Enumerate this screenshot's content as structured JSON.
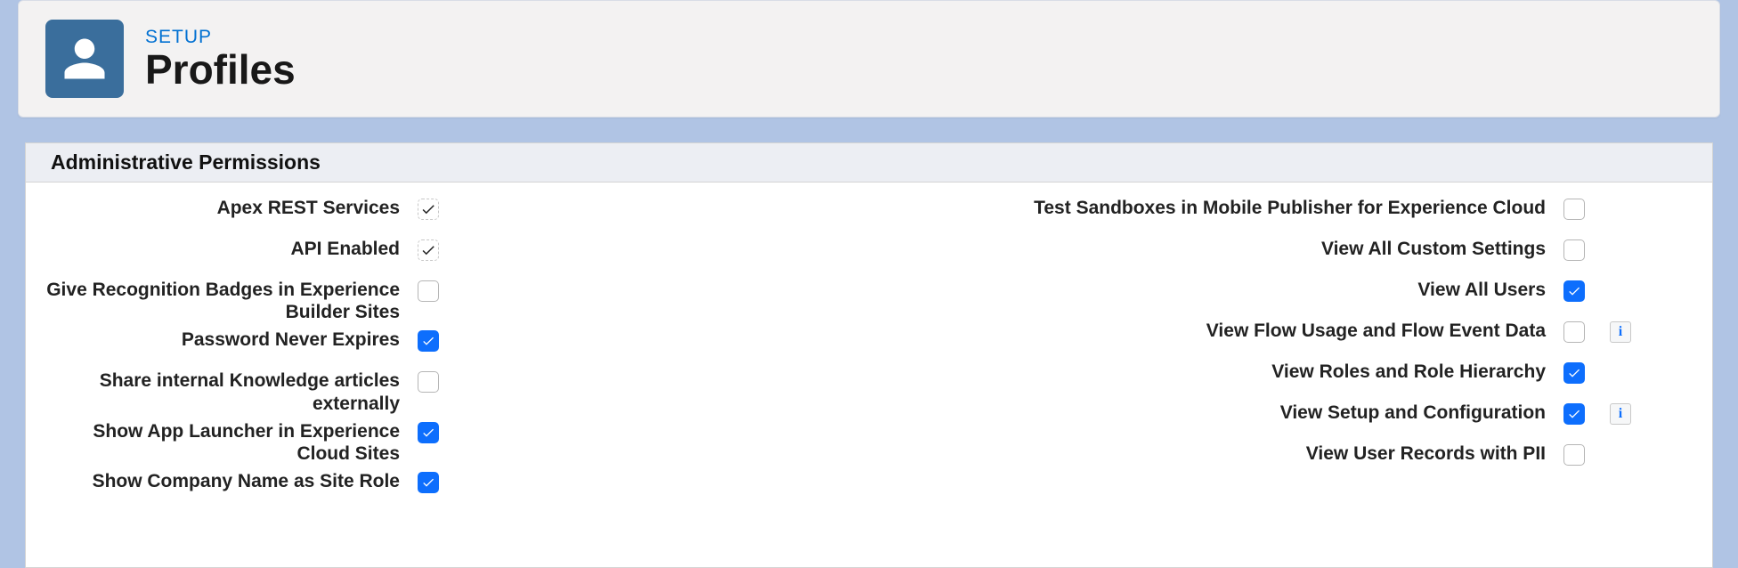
{
  "header": {
    "eyebrow": "SETUP",
    "title": "Profiles"
  },
  "section": {
    "title": "Administrative Permissions"
  },
  "perms": {
    "left": [
      {
        "id": "apex-rest-services",
        "label": "Apex REST Services",
        "checked": true,
        "locked": true,
        "info": false
      },
      {
        "id": "api-enabled",
        "label": "API Enabled",
        "checked": true,
        "locked": true,
        "info": false
      },
      {
        "id": "give-recognition-badges",
        "label": "Give Recognition Badges in Experience Builder Sites",
        "checked": false,
        "locked": false,
        "info": false
      },
      {
        "id": "password-never-expires",
        "label": "Password Never Expires",
        "checked": true,
        "locked": false,
        "info": false
      },
      {
        "id": "share-internal-knowledge",
        "label": "Share internal Knowledge articles externally",
        "checked": false,
        "locked": false,
        "info": false
      },
      {
        "id": "show-app-launcher",
        "label": "Show App Launcher in Experience Cloud Sites",
        "checked": true,
        "locked": false,
        "info": false
      },
      {
        "id": "show-company-name",
        "label": "Show Company Name as Site Role",
        "checked": true,
        "locked": false,
        "info": false
      }
    ],
    "right": [
      {
        "id": "test-sandboxes",
        "label": "Test Sandboxes in Mobile Publisher for Experience Cloud",
        "checked": false,
        "locked": false,
        "info": false
      },
      {
        "id": "view-all-custom-settings",
        "label": "View All Custom Settings",
        "checked": false,
        "locked": false,
        "info": false
      },
      {
        "id": "view-all-users",
        "label": "View All Users",
        "checked": true,
        "locked": false,
        "info": false
      },
      {
        "id": "view-flow-usage",
        "label": "View Flow Usage and Flow Event Data",
        "checked": false,
        "locked": false,
        "info": true
      },
      {
        "id": "view-roles-hierarchy",
        "label": "View Roles and Role Hierarchy",
        "checked": true,
        "locked": false,
        "info": false
      },
      {
        "id": "view-setup-config",
        "label": "View Setup and Configuration",
        "checked": true,
        "locked": false,
        "info": true
      },
      {
        "id": "view-user-records-pii",
        "label": "View User Records with PII",
        "checked": false,
        "locked": false,
        "info": false
      }
    ]
  },
  "info_glyph": "i"
}
